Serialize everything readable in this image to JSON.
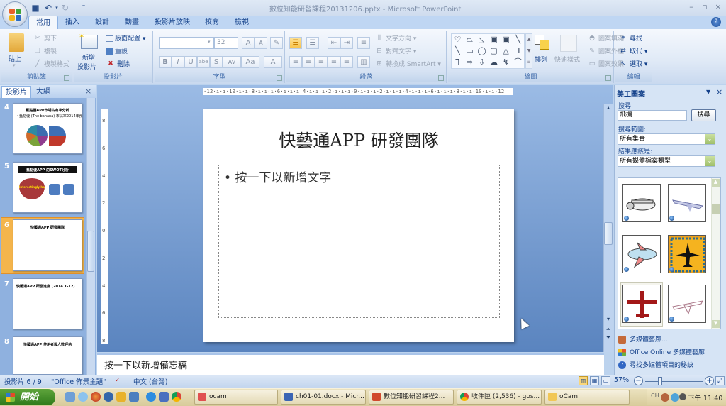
{
  "window": {
    "title": "數位知能研習課程20131206.pptx - Microsoft PowerPoint",
    "controls": {
      "minimize": "–",
      "maximize": "▫",
      "close": "×"
    }
  },
  "quick_access": {
    "save_icon": "save-icon",
    "undo_icon": "undo-icon",
    "redo_icon": "redo-icon",
    "customize": "⁼"
  },
  "tabs": [
    {
      "label": "常用",
      "active": true
    },
    {
      "label": "插入"
    },
    {
      "label": "設計"
    },
    {
      "label": "動畫"
    },
    {
      "label": "投影片放映"
    },
    {
      "label": "校閱"
    },
    {
      "label": "檢視"
    }
  ],
  "ribbon": {
    "clipboard": {
      "label": "剪貼簿",
      "paste": "貼上",
      "cut": "剪下",
      "copy": "複製",
      "format_painter": "複製格式"
    },
    "slides": {
      "label": "投影片",
      "new_slide_1": "新增",
      "new_slide_2": "投影片",
      "layout": "版面配置",
      "reset": "重設",
      "delete": "刪除"
    },
    "font": {
      "label": "字型",
      "font_name": "",
      "font_size": "32",
      "grow": "A",
      "shrink": "A",
      "clear": "✎",
      "bold": "B",
      "italic": "I",
      "underline": "U",
      "strike": "abe",
      "shadow": "S",
      "spacing": "AV",
      "case": "Aa",
      "color": "A"
    },
    "paragraph": {
      "label": "段落",
      "text_direction": "文字方向",
      "align_text": "對齊文字",
      "smartart": "轉換成 SmartArt"
    },
    "drawing": {
      "label": "繪圖",
      "arrange": "排列",
      "quick_styles": "快速樣式",
      "shape_fill": "圖案填滿",
      "shape_outline": "圖案外框",
      "shape_effects": "圖案效果",
      "shapes": [
        "♡",
        "⏢",
        "◺",
        "▣",
        "▣",
        "╲",
        "╲",
        "▭",
        "◯",
        "▢",
        "△",
        "⅂",
        "⅂",
        "⇨",
        "⇩",
        "☁",
        "↯",
        "⌒"
      ]
    },
    "editing": {
      "label": "編輯",
      "find": "尋找",
      "replace": "取代",
      "select": "選取"
    }
  },
  "left_pane": {
    "tabs": [
      {
        "label": "投影片",
        "active": true
      },
      {
        "label": "大綱"
      }
    ],
    "close": "×",
    "slides": [
      {
        "num": "4",
        "title": "藍點優APP市場占有率分析",
        "sub": "‧ 藍點優 (The banana) 市佔率2014年預測"
      },
      {
        "num": "5",
        "title": "藍點優APP 的SWOT分析",
        "heart_text": "Interestingly happy"
      },
      {
        "num": "6",
        "title": "快藝通APP 研發團隊",
        "selected": true
      },
      {
        "num": "7",
        "title": "快藝通APP 研發進度 (2014.1-12)"
      },
      {
        "num": "8",
        "title": "快藝通APP 使用者與人數評估"
      }
    ]
  },
  "ruler": {
    "horizontal": "·12·ı·ı·10·ı·ı·8·ı·ı·ı·6·ı·ı·ı·4·ı·ı·ı·2·ı·ı·ı·0·ı·ı·ı·2·ı·ı·ı·4·ı·ı·ı·6·ı·ı·ı·8·ı·ı·10·ı·ı·12·",
    "vertical": [
      "8",
      "6",
      "4",
      "2",
      "0",
      "2",
      "4",
      "6",
      "8"
    ]
  },
  "slide": {
    "title": "快藝通APP 研發團隊",
    "body_placeholder": "按一下以新增文字",
    "bullet": "•"
  },
  "notes": {
    "placeholder": "按一下以新增備忘稿"
  },
  "clipart_pane": {
    "title": "美工圖案",
    "search_label": "搜尋:",
    "search_value": "飛機",
    "search_button": "搜尋",
    "scope_label": "搜尋範圍:",
    "scope_value": "所有集合",
    "results_label": "結果應該是:",
    "results_value": "所有媒體檔案類型",
    "results": [
      "cartoon-propeller-plane",
      "jet-airliner",
      "cartoon-airplane",
      "airplane-stamp",
      "red-airplane-silhouette",
      "sketch-airliner"
    ],
    "links": [
      "多媒體藝廊...",
      "Office Online 多媒體藝廊",
      "尋找多媒體項目的秘訣"
    ]
  },
  "status_bar": {
    "slide_info": "投影片 6 / 9",
    "theme": "\"Office 佈景主題\"",
    "language": "中文 (台灣)",
    "zoom": "57%",
    "zoom_level_percent": 57
  },
  "taskbar": {
    "start": "開始",
    "tasks": [
      {
        "label": "ocam"
      },
      {
        "label": "ch01-01.docx - Micr..."
      },
      {
        "label": "數位知能研習課程2..."
      },
      {
        "label": "收件匣 (2,536) - gos..."
      },
      {
        "label": "oCam"
      }
    ],
    "tray_lang": "CH",
    "clock": "下午 11:40"
  },
  "colors": {
    "accent": "#15428b",
    "selected_slide": "#f4b54c",
    "ribbon_bg": "#dfe9f6",
    "start_green": "#3b8a22"
  }
}
